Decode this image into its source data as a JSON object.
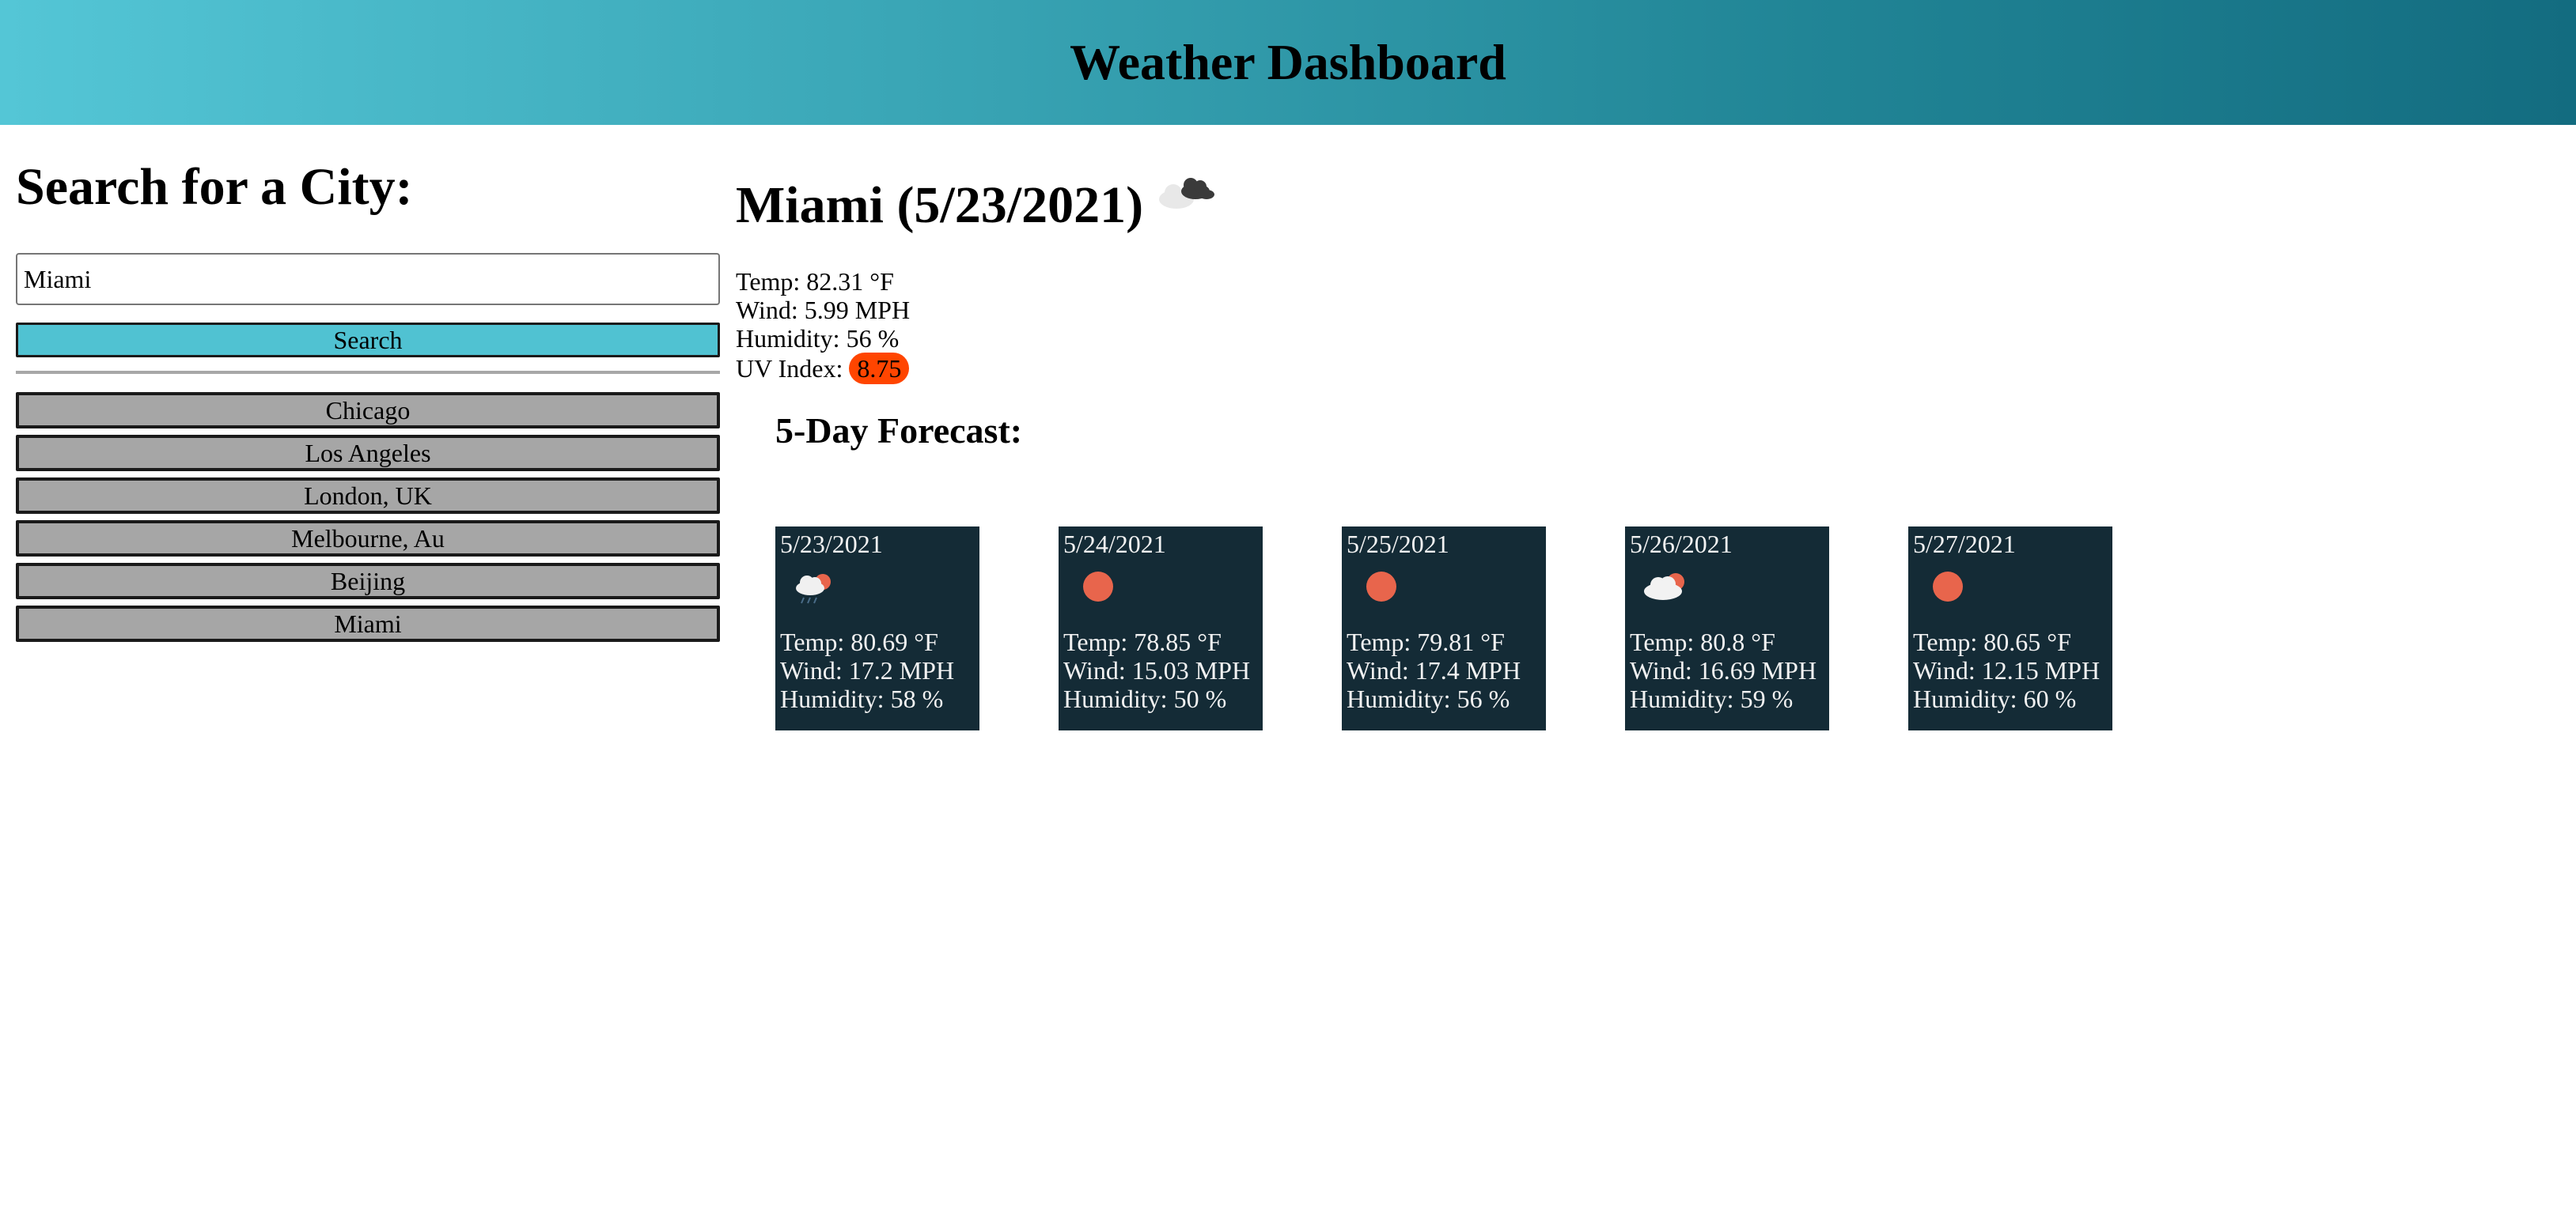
{
  "app": {
    "title": "Weather Dashboard"
  },
  "search": {
    "heading": "Search for a City:",
    "input_value": "Miami",
    "button_label": "Search"
  },
  "history": [
    "Chicago",
    "Los Angeles",
    "London, UK",
    "Melbourne, Au",
    "Beijing",
    "Miami"
  ],
  "current": {
    "title": "Miami (5/23/2021)",
    "icon": "broken-clouds-icon",
    "temp": "Temp: 82.31 °F",
    "wind": "Wind: 5.99 MPH",
    "humidity": "Humidity: 56 %",
    "uv_label": "UV Index: ",
    "uv_value": "8.75",
    "uv_color": "#ff4500"
  },
  "forecast": {
    "heading": "5-Day Forecast:",
    "days": [
      {
        "date": "5/23/2021",
        "icon": "light-rain-icon",
        "temp": "Temp: 80.69 °F",
        "wind": "Wind: 17.2 MPH",
        "humidity": "Humidity: 58 %"
      },
      {
        "date": "5/24/2021",
        "icon": "clear-sky-icon",
        "temp": "Temp: 78.85 °F",
        "wind": "Wind: 15.03 MPH",
        "humidity": "Humidity: 50 %"
      },
      {
        "date": "5/25/2021",
        "icon": "clear-sky-icon",
        "temp": "Temp: 79.81 °F",
        "wind": "Wind: 17.4 MPH",
        "humidity": "Humidity: 56 %"
      },
      {
        "date": "5/26/2021",
        "icon": "few-clouds-icon",
        "temp": "Temp: 80.8 °F",
        "wind": "Wind: 16.69 MPH",
        "humidity": "Humidity: 59 %"
      },
      {
        "date": "5/27/2021",
        "icon": "clear-sky-icon",
        "temp": "Temp: 80.65 °F",
        "wind": "Wind: 12.15 MPH",
        "humidity": "Humidity: 60 %"
      }
    ]
  },
  "colors": {
    "header_gradient": [
      "#54c6d6",
      "#136c80"
    ],
    "search_button": "#50c2d2",
    "history_button": "#a6a6a6",
    "card_bg": "#142b36",
    "sun": "#e8654c"
  }
}
